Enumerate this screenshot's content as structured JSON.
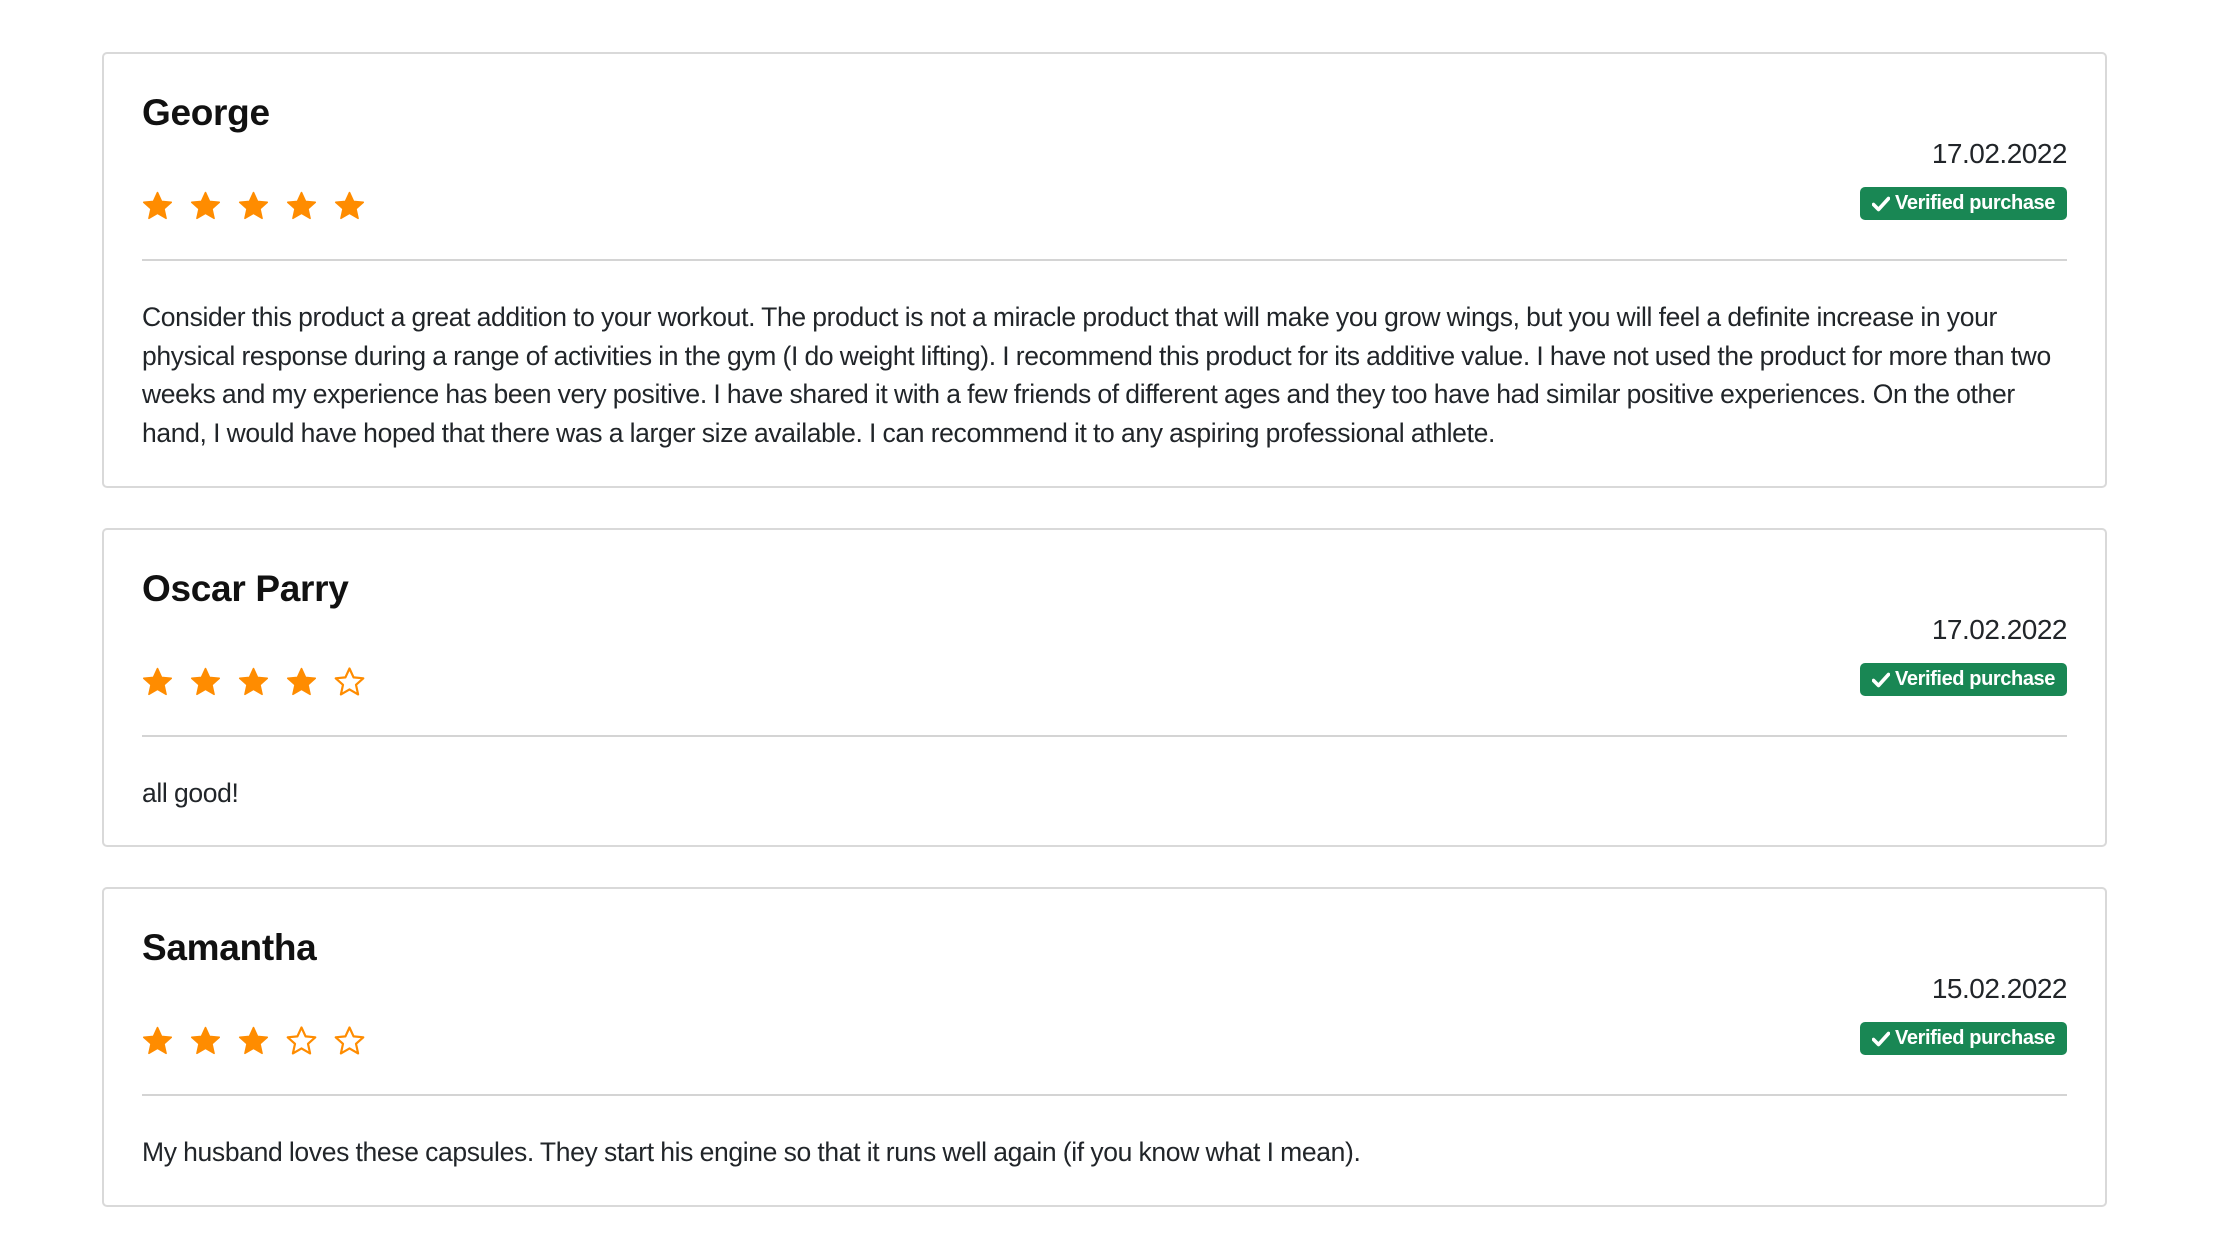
{
  "reviews": [
    {
      "name": "George",
      "rating": 5,
      "max_rating": 5,
      "date": "17.02.2022",
      "badge": "Verified purchase",
      "text": "Consider this product a great addition to your workout. The product is not a miracle product that will make you grow wings, but you will feel a definite increase in your physical response during a range of activities in the gym (I do weight lifting). I recommend this product for its additive value. I have not used the product for more than two weeks and my experience has been very positive. I have shared it with a few friends of different ages and they too have had similar positive experiences. On the other hand, I would have hoped that there was a larger size available. I can recommend it to any aspiring professional athlete."
    },
    {
      "name": "Oscar Parry",
      "rating": 4,
      "max_rating": 5,
      "date": "17.02.2022",
      "badge": "Verified purchase",
      "text": "all good!"
    },
    {
      "name": "Samantha",
      "rating": 3,
      "max_rating": 5,
      "date": "15.02.2022",
      "badge": "Verified purchase",
      "text": "My husband loves these capsules. They start his engine so that it runs well again (if you know what I mean)."
    }
  ],
  "colors": {
    "star": "#FF8C00",
    "badge_bg": "#198754",
    "badge_text": "#FFFFFF",
    "border": "#D9D9D9"
  },
  "icons": {
    "star_filled": "star-filled-icon",
    "star_empty": "star-outline-icon",
    "verified": "check-icon"
  }
}
